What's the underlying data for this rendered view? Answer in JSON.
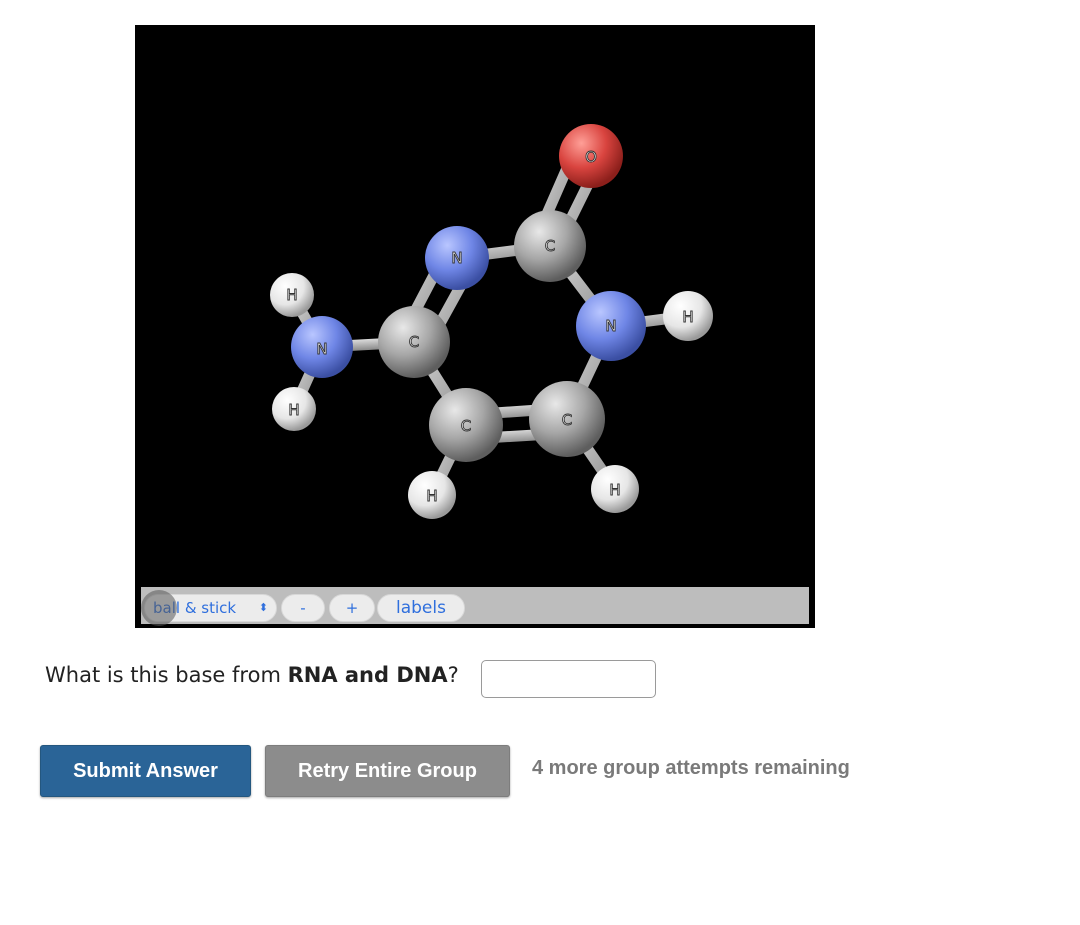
{
  "viewer": {
    "atoms": {
      "o1": "O",
      "c1": "C",
      "n1": "N",
      "n2": "N",
      "h1": "H",
      "h2": "H",
      "n3": "N",
      "c2": "C",
      "h3": "H",
      "c3": "C",
      "c4": "C",
      "h4": "H",
      "h5": "H"
    },
    "colors": {
      "carbon": "#a8a8a8",
      "nitrogen": "#6f86e6",
      "oxygen": "#d9443f",
      "hydrogen": "#eeeeee",
      "bond": "#b5b5b5",
      "background": "#000000"
    },
    "toolbar": {
      "style_select": "ball & stick",
      "zoom_out": "-",
      "zoom_in": "+",
      "labels": "labels"
    }
  },
  "question": {
    "prefix": "What is this base from ",
    "emphasis": "RNA and DNA",
    "suffix": "?",
    "answer_value": ""
  },
  "actions": {
    "submit": "Submit Answer",
    "retry": "Retry Entire Group",
    "attempts": "4 more group attempts remaining"
  }
}
